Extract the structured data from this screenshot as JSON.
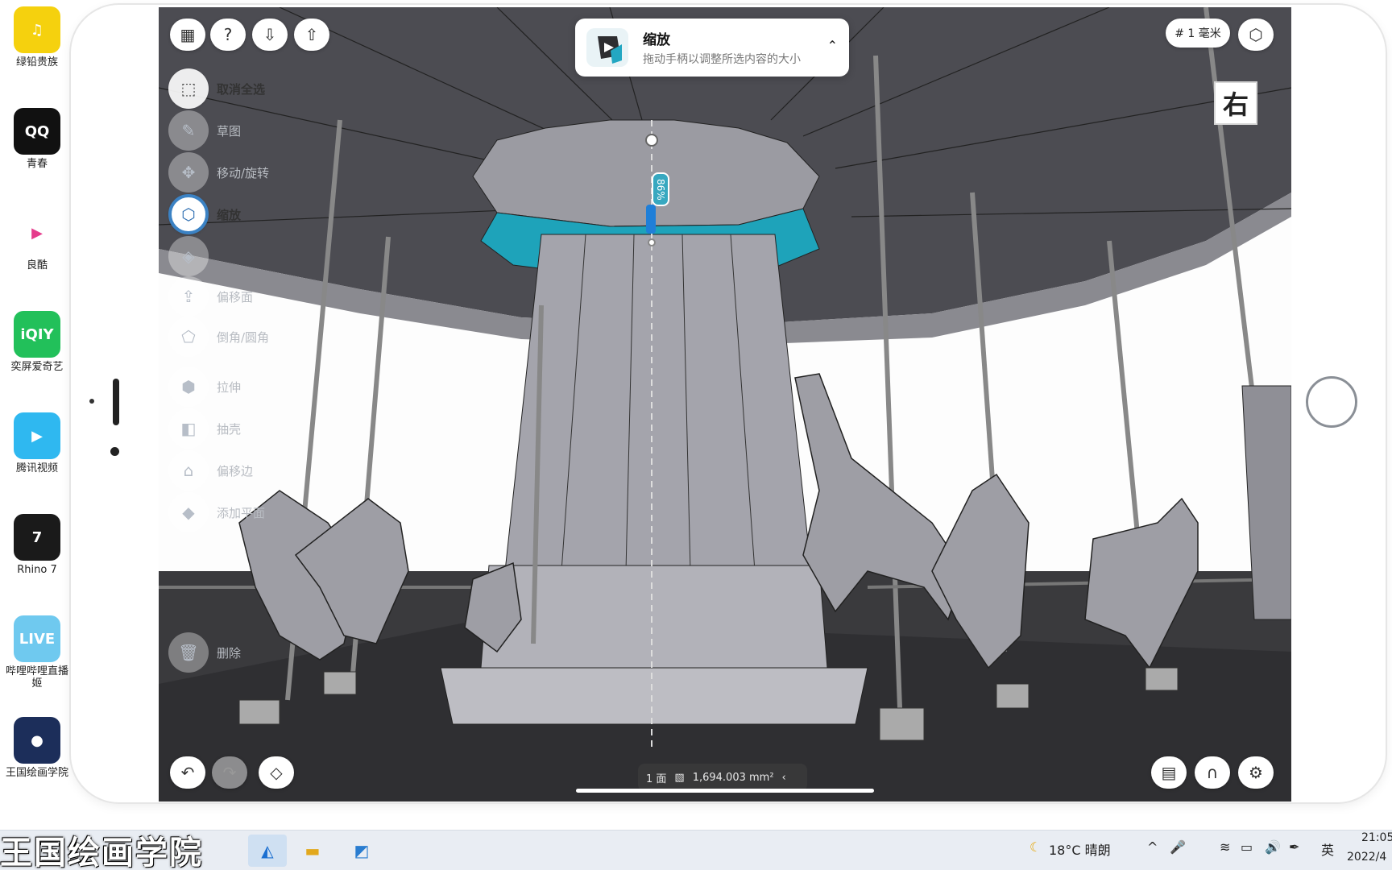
{
  "desktop_icons": [
    {
      "label": "绿铅贵族",
      "color": "#f5d10e",
      "glyph": "♫"
    },
    {
      "label": "青春",
      "color": "#111111",
      "glyph": "QQ"
    },
    {
      "label": "良酷",
      "color": "#ffffff",
      "glyph": "▶"
    },
    {
      "label": "奕屏爱奇艺",
      "color": "#22c05a",
      "glyph": "iQIY"
    },
    {
      "label": "腾讯视频",
      "color": "#2fb8f0",
      "glyph": "▶"
    },
    {
      "label": "Rhino 7",
      "color": "#1a1a1a",
      "glyph": "7"
    },
    {
      "label": "哔哩哔哩直播姬",
      "color": "#6fc9ef",
      "glyph": "LIVE"
    },
    {
      "label": "王国绘画学院",
      "color": "#1c2e5a",
      "glyph": "●"
    }
  ],
  "app": {
    "notice": {
      "title": "缩放",
      "subtitle": "拖动手柄以调整所选内容的大小"
    },
    "units": "# 1 毫米",
    "view_label": "右",
    "percent": "86%",
    "tools": [
      {
        "label": "取消全选",
        "icon": "deselect-icon",
        "glyph": "⬚",
        "state": "normal"
      },
      {
        "label": "草图",
        "icon": "sketch-pen-icon",
        "glyph": "✎",
        "state": "faded"
      },
      {
        "label": "移动/旋转",
        "icon": "move-rotate-icon",
        "glyph": "✥",
        "state": "faded"
      },
      {
        "label": "缩放",
        "icon": "scale-cube-icon",
        "glyph": "⬡",
        "state": "active"
      },
      {
        "label": "",
        "icon": "cube-icon",
        "glyph": "◈",
        "state": "faded"
      },
      {
        "label": "偏移面",
        "icon": "offset-face-icon",
        "glyph": "⇪",
        "state": "faded"
      },
      {
        "label": "倒角/圆角",
        "icon": "fillet-icon",
        "glyph": "⬠",
        "state": "faded"
      },
      {
        "label": "拉伸",
        "icon": "extrude-icon",
        "glyph": "⬢",
        "state": "faded"
      },
      {
        "label": "抽壳",
        "icon": "shell-icon",
        "glyph": "◧",
        "state": "faded"
      },
      {
        "label": "偏移边",
        "icon": "offset-edge-icon",
        "glyph": "⌂",
        "state": "faded"
      },
      {
        "label": "添加平面",
        "icon": "add-plane-icon",
        "glyph": "◆",
        "state": "faded"
      },
      {
        "label": "删除",
        "icon": "trash-icon",
        "glyph": "🗑",
        "state": "faded"
      }
    ],
    "status": {
      "faces": "1 面",
      "area": "1,694.003 mm²"
    }
  },
  "taskbar": {
    "watermark": "王国绘画学院",
    "weather": "18°C 晴朗",
    "ime": "英",
    "time": "21:05",
    "date": "2022/4"
  }
}
